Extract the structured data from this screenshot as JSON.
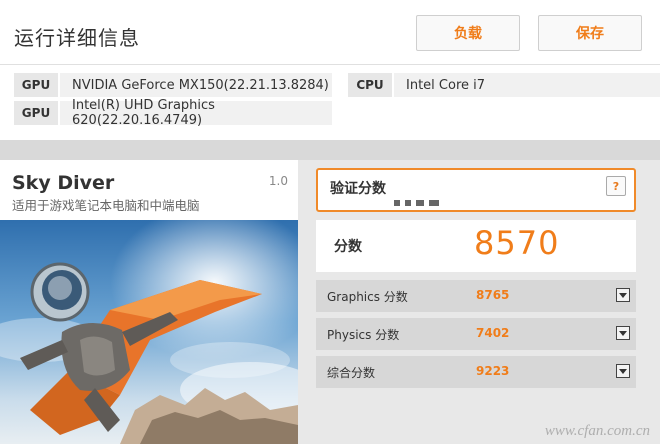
{
  "header": {
    "title": "运行详细信息",
    "load_label": "负载",
    "save_label": "保存"
  },
  "hardware": {
    "gpu1": {
      "key": "GPU",
      "value": "NVIDIA GeForce MX150(22.21.13.8284)"
    },
    "gpu2": {
      "key": "GPU",
      "value": "Intel(R) UHD Graphics 620(22.20.16.4749)"
    },
    "cpu": {
      "key": "CPU",
      "value": "Intel Core i7"
    }
  },
  "test": {
    "name": "Sky Diver",
    "version": "1.0",
    "description": "适用于游戏笔记本电脑和中端电脑"
  },
  "scores": {
    "valid_label": "验证分数",
    "help_label": "?",
    "total_label": "分数",
    "total_value": "8570",
    "rows": [
      {
        "label": "Graphics 分数",
        "value": "8765"
      },
      {
        "label": "Physics 分数",
        "value": "7402"
      },
      {
        "label": "综合分数",
        "value": "9223"
      }
    ]
  },
  "watermark": "www.cfan.com.cn",
  "colors": {
    "accent": "#f07d1a",
    "panel_bg": "#ffffff",
    "page_bg": "#d9d9d9"
  },
  "icons": {
    "help": "question-mark-icon",
    "expand": "chevron-down-icon"
  }
}
